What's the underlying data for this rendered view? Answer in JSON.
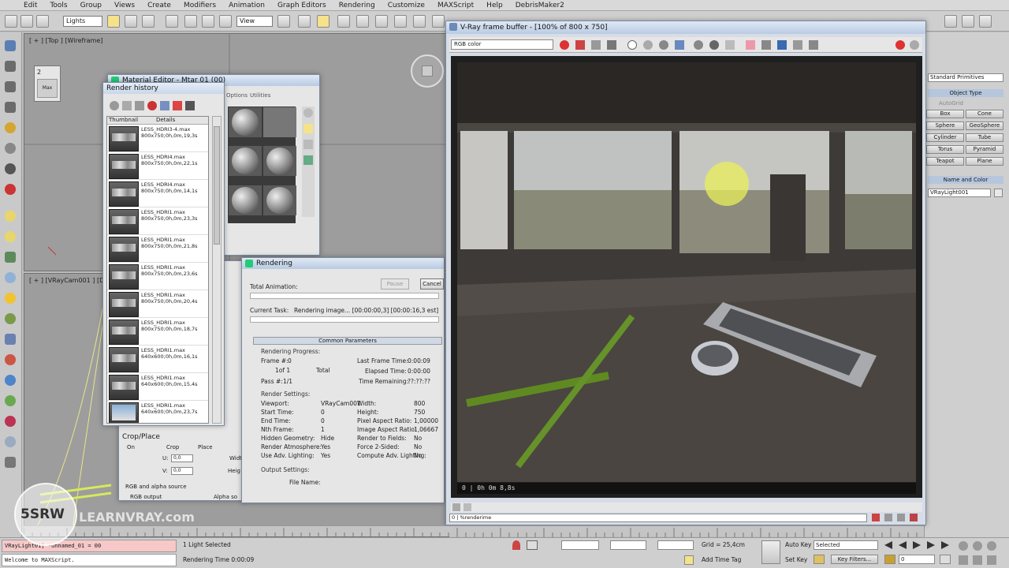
{
  "menu": [
    "Edit",
    "Tools",
    "Group",
    "Views",
    "Create",
    "Modifiers",
    "Animation",
    "Graph Editors",
    "Rendering",
    "Customize",
    "MAXScript",
    "Help",
    "DebrisMaker2"
  ],
  "toolbar": {
    "selection_filter": "Lights",
    "coord_system": "View"
  },
  "viewport": {
    "top_label": "[ + ] [Top ] [Wireframe]",
    "bottom_label": "[ + ] [VRayCam001 ] [Default Shading]",
    "badge": "2",
    "badge_sub": "Max"
  },
  "render_history": {
    "title": "Render history",
    "col_thumb": "Thumbnail",
    "col_details": "Details",
    "items": [
      {
        "name": "LESS_HDRI3-4.max",
        "info": "800x750;0h,0m,19,3s",
        "blue": false
      },
      {
        "name": "LESS_HDRI4.max",
        "info": "800x750;0h,0m,22,1s",
        "blue": false
      },
      {
        "name": "LESS_HDRI4.max",
        "info": "800x750;0h,0m,14,1s",
        "blue": false
      },
      {
        "name": "LESS_HDRI1.max",
        "info": "800x750;0h,0m,23,3s",
        "blue": false
      },
      {
        "name": "LESS_HDRI1.max",
        "info": "800x750;0h,0m,21,8s",
        "blue": false
      },
      {
        "name": "LESS_HDRI1.max",
        "info": "800x750;0h,0m,23,6s",
        "blue": false
      },
      {
        "name": "LESS_HDRI1.max",
        "info": "800x750;0h,0m,20,4s",
        "blue": false
      },
      {
        "name": "LESS_HDRI1.max",
        "info": "800x750;0h,0m,18,7s",
        "blue": false
      },
      {
        "name": "LESS_HDRI1.max",
        "info": "640x600;0h,0m,16,1s",
        "blue": false
      },
      {
        "name": "LESS_HDRI1.max",
        "info": "640x600;0h,0m,15,4s",
        "blue": false
      },
      {
        "name": "LESS_HDRI1.max",
        "info": "640x600;0h,0m,23,7s",
        "blue": true
      }
    ]
  },
  "material_editor": {
    "title": "Material Editor - Mtar 01 (00)",
    "tabs": [
      "Options",
      "Utilities"
    ]
  },
  "rendering": {
    "title": "Rendering",
    "total_animation": "Total Animation:",
    "pause": "Pause",
    "cancel": "Cancel",
    "current_task_label": "Current Task:",
    "current_task": "Rendering image... [00:00:00,3] [00:00:16,3 est]",
    "common_parameters": "Common Parameters",
    "progress_title": "Rendering Progress:",
    "frame_label": "Frame #:",
    "frame_value": "0",
    "of_value": "1of 1",
    "total": "Total",
    "pass_label": "Pass #:",
    "pass_value": "1/1",
    "last_frame_time": "Last Frame Time:",
    "last_frame_value": "0:00:09",
    "elapsed_time": "Elapsed Time:",
    "elapsed_value": "0:00:00",
    "time_remaining": "Time Remaining:",
    "remaining_value": "??:??:??",
    "settings_title": "Render Settings:",
    "settings_left": [
      [
        "Viewport:",
        "VRayCam001"
      ],
      [
        "Start Time:",
        "0"
      ],
      [
        "End Time:",
        "0"
      ],
      [
        "Nth Frame:",
        "1"
      ],
      [
        "Hidden Geometry:",
        "Hide"
      ],
      [
        "Render Atmosphere:",
        "Yes"
      ],
      [
        "Use Adv. Lighting:",
        "Yes"
      ]
    ],
    "settings_right": [
      [
        "Width:",
        "800"
      ],
      [
        "Height:",
        "750"
      ],
      [
        "Pixel Aspect Ratio:",
        "1,00000"
      ],
      [
        "Image Aspect Ratio:",
        "1,06667"
      ],
      [
        "Render to Fields:",
        "No"
      ],
      [
        "Force 2-Sided:",
        "No"
      ],
      [
        "Compute Adv. Lighting:",
        "No"
      ]
    ],
    "output_title": "Output Settings:",
    "file_name": "File Name:"
  },
  "crop": {
    "title": "Crop/Place",
    "on": "On",
    "crop": "Crop",
    "place": "Place",
    "u_label": "U:",
    "u_value": "0,0",
    "v_label": "V:",
    "v_value": "0,0",
    "width": "Width",
    "height": "Heig",
    "rgb_alpha": "RGB and alpha source",
    "rgb_output": "RGB output",
    "alpha_source": "Alpha so"
  },
  "vfb": {
    "title": "V-Ray frame buffer - [100% of 800 x 750]",
    "channel": "RGB color",
    "status": "0 | 0h 0m 8,8s",
    "bottom_field": "0 | %renderime"
  },
  "command_panel": {
    "category": "Standard Primitives",
    "object_type": "Object Type",
    "autogrid": "AutoGrid",
    "buttons": [
      "Box",
      "Cone",
      "Sphere",
      "GeoSphere",
      "Cylinder",
      "Tube",
      "Torus",
      "Pyramid",
      "Teapot",
      "Plane"
    ],
    "name_color": "Name and Color",
    "name_value": "VRayLight001"
  },
  "status_bar": {
    "script_line1": "VRayLight01] -unnamed_01 = 00",
    "script_line2": "Welcome to MAXScript.",
    "selected": "1 Light Selected",
    "render_time": "Rendering Time 0:00:09",
    "grid": "Grid = 25,4cm",
    "add_time_tag": "Add Time Tag",
    "auto_key": "Auto Key",
    "set_key": "Set Key",
    "selected_dd": "Selected",
    "key_filters": "Key Filters...",
    "frame": "0"
  },
  "watermark": {
    "logo": "5SRW",
    "site": "LEARNVRAY.com"
  },
  "colors": {
    "viewport": "#9d9d9d",
    "vfb_bg": "#5a5a5a",
    "title_bar": "#c8d7ea",
    "render_green": "#5a8a2a"
  }
}
